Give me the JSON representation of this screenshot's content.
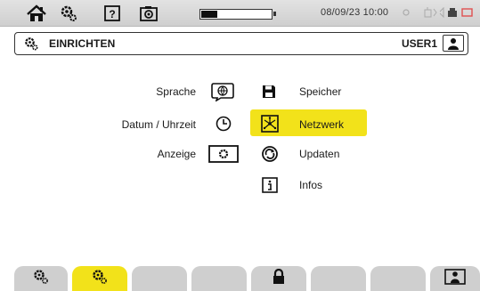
{
  "status_bar": {
    "datetime": "08/09/23 10:00",
    "battery_level": 0.22,
    "icons": [
      "home-icon",
      "settings-icon",
      "help-icon",
      "screenshot-icon",
      "battery-icon",
      "status-dot-icon",
      "connection-icon",
      "storage-icon"
    ]
  },
  "header": {
    "title": "EINRICHTEN",
    "user": "USER1",
    "icon": "setup-gear-icon"
  },
  "menu": {
    "left_items": [
      {
        "label": "Sprache",
        "icon": "language-icon"
      },
      {
        "label": "Datum / Uhrzeit",
        "icon": "clock-icon"
      },
      {
        "label": "Anzeige",
        "icon": "display-icon"
      }
    ],
    "right_items": [
      {
        "label": "Speicher",
        "icon": "save-icon"
      },
      {
        "label": "Netzwerk",
        "icon": "network-icon",
        "selected": true
      },
      {
        "label": "Updaten",
        "icon": "update-icon"
      },
      {
        "label": "Infos",
        "icon": "info-icon"
      }
    ]
  },
  "tabs": [
    {
      "icon": "settings-tab-icon",
      "active": false
    },
    {
      "icon": "setup-tab-icon",
      "active": true
    },
    {
      "icon": "",
      "active": false
    },
    {
      "icon": "",
      "active": false
    },
    {
      "icon": "lock-icon",
      "active": false
    },
    {
      "icon": "",
      "active": false
    },
    {
      "icon": "",
      "active": false
    },
    {
      "icon": "user-tab-icon",
      "active": false
    }
  ],
  "colors": {
    "accent": "#f2e21a",
    "tab_gray": "#cfcfcf"
  }
}
